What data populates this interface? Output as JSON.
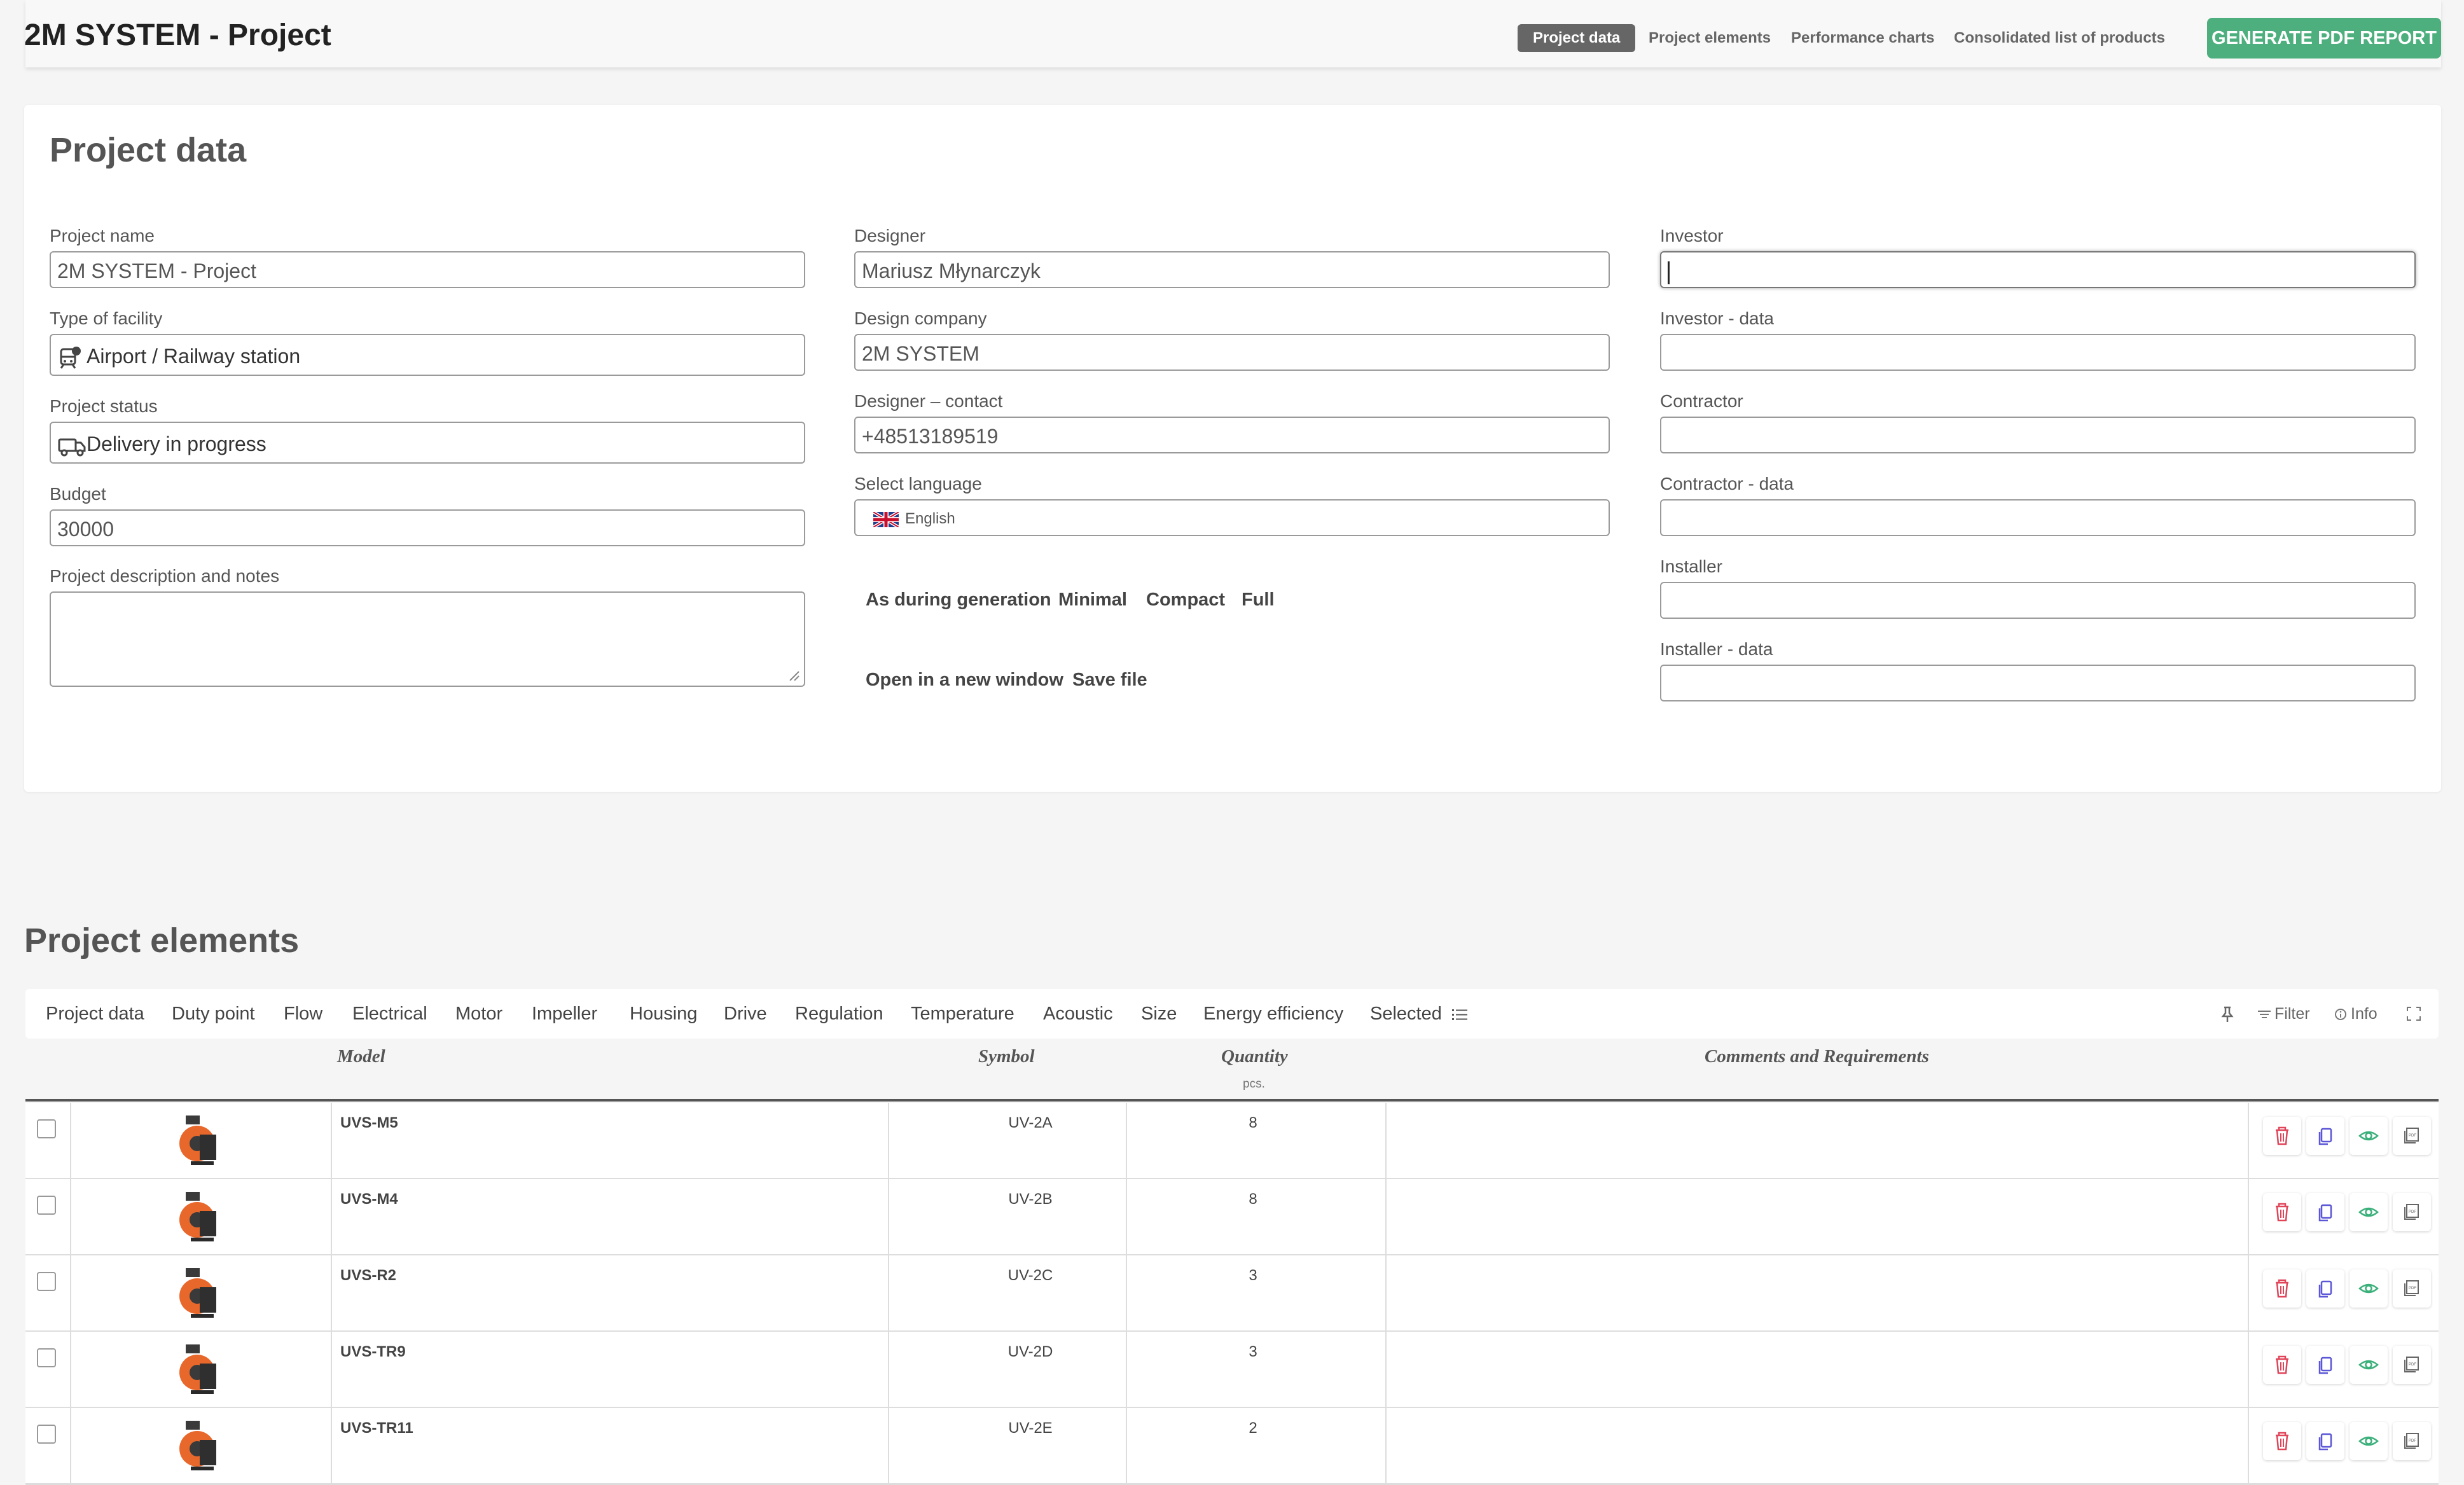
{
  "header": {
    "title": "2M SYSTEM - Project",
    "nav": [
      "Project data",
      "Project elements",
      "Performance charts",
      "Consolidated list of products"
    ],
    "generate_button": "GENERATE PDF REPORT"
  },
  "project_data": {
    "title": "Project data",
    "project_name_label": "Project name",
    "project_name_value": "2M SYSTEM - Project",
    "facility_label": "Type of facility",
    "facility_value": "Airport / Railway station",
    "status_label": "Project status",
    "status_value": "Delivery in progress",
    "budget_label": "Budget",
    "budget_value": "30000",
    "description_label": "Project description and notes",
    "designer_label": "Designer",
    "designer_value": "Mariusz Młynarczyk",
    "company_label": "Design company",
    "company_value": "2M SYSTEM",
    "contact_label": "Designer – contact",
    "contact_value": "+48513189519",
    "language_label": "Select language",
    "language_value": "English",
    "report_options": [
      "As during generation",
      "Minimal",
      "Compact",
      "Full"
    ],
    "file_options": [
      "Open in a new window",
      "Save file"
    ],
    "investor_label": "Investor",
    "investor_data_label": "Investor - data",
    "contractor_label": "Contractor",
    "contractor_data_label": "Contractor - data",
    "installer_label": "Installer",
    "installer_data_label": "Installer - data"
  },
  "elements": {
    "title": "Project elements",
    "tabs": [
      "Project data",
      "Duty point",
      "Flow",
      "Electrical",
      "Motor",
      "Impeller",
      "Housing",
      "Drive",
      "Regulation",
      "Temperature",
      "Acoustic",
      "Size",
      "Energy efficiency",
      "Selected"
    ],
    "tools": {
      "filter": "Filter",
      "info": "Info"
    },
    "columns": {
      "model": "Model",
      "symbol": "Symbol",
      "quantity": "Quantity",
      "quantity_unit": "pcs.",
      "comments": "Comments and Requirements"
    },
    "rows": [
      {
        "model": "UVS-M5",
        "symbol": "UV-2A",
        "quantity": "8"
      },
      {
        "model": "UVS-M4",
        "symbol": "UV-2B",
        "quantity": "8"
      },
      {
        "model": "UVS-R2",
        "symbol": "UV-2C",
        "quantity": "3"
      },
      {
        "model": "UVS-TR9",
        "symbol": "UV-2D",
        "quantity": "3"
      },
      {
        "model": "UVS-TR11",
        "symbol": "UV-2E",
        "quantity": "2"
      }
    ]
  },
  "colors": {
    "accent_green": "#4caf7d",
    "delete_red": "#e0455a",
    "copy_blue": "#5b57d6",
    "view_green": "#3bb07a"
  }
}
